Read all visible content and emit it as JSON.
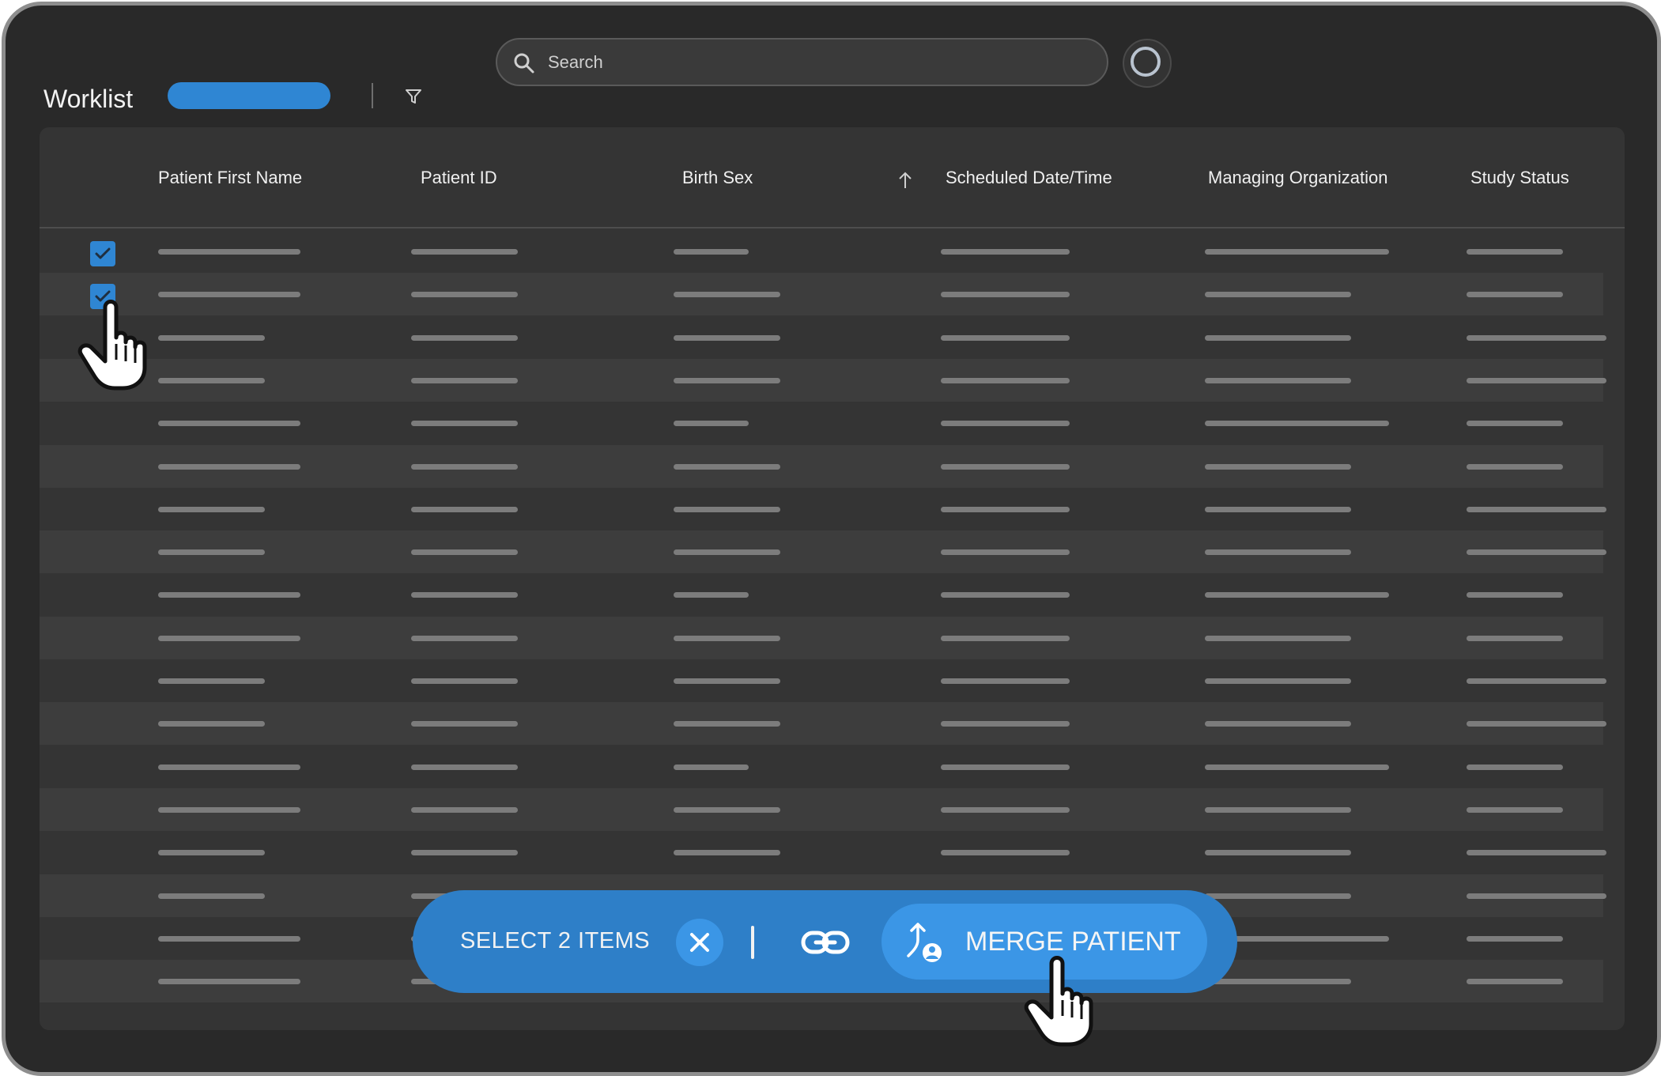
{
  "header": {
    "title": "Worklist",
    "search_placeholder": "Search"
  },
  "table": {
    "columns": [
      "Patient First Name",
      "Patient ID",
      "Birth Sex",
      "Scheduled Date/Time",
      "Managing Organization",
      "Study Status"
    ],
    "sorted_column": "Scheduled Date/Time",
    "sort_direction": "ascending",
    "row_count": 18,
    "selected_rows": [
      1,
      2
    ]
  },
  "action_bar": {
    "selection_label": "SELECT 2 ITEMS",
    "merge_label": "MERGE PATIENT"
  },
  "icons": {
    "search": "search-icon",
    "filter": "filter-icon",
    "sort": "arrow-up-icon",
    "close": "close-icon",
    "link": "link-icon",
    "merge": "merge-patient-icon",
    "cursor": "hand-pointer-icon"
  },
  "colors": {
    "accent": "#2f86d3",
    "action_bar": "#2e7fc8",
    "button": "#3b96e6",
    "background": "#292929",
    "panel": "#343434"
  }
}
